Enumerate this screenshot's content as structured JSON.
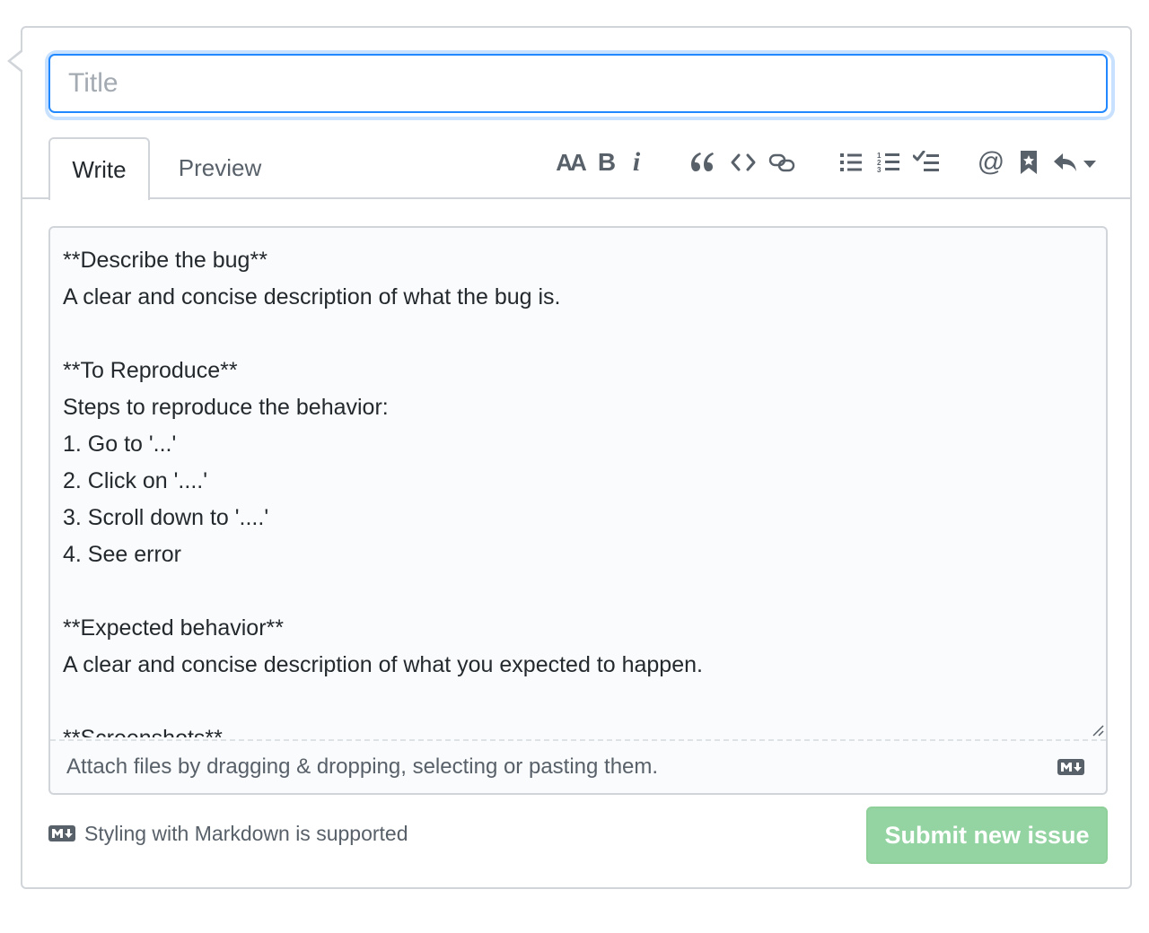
{
  "title": {
    "value": "",
    "placeholder": "Title"
  },
  "tabs": [
    {
      "label": "Write",
      "active": true
    },
    {
      "label": "Preview",
      "active": false
    }
  ],
  "toolbar": {
    "items": [
      {
        "name": "text-size-icon",
        "glyph": "AA"
      },
      {
        "name": "bold-icon",
        "glyph": "B"
      },
      {
        "name": "italic-icon",
        "glyph": "i"
      },
      {
        "name": "quote-icon"
      },
      {
        "name": "code-icon"
      },
      {
        "name": "link-icon"
      },
      {
        "name": "unordered-list-icon"
      },
      {
        "name": "ordered-list-icon"
      },
      {
        "name": "task-list-icon"
      },
      {
        "name": "mention-icon",
        "glyph": "@"
      },
      {
        "name": "reference-icon"
      },
      {
        "name": "reply-icon"
      },
      {
        "name": "dropdown-caret-icon"
      }
    ]
  },
  "editor": {
    "lines": [
      "**Describe the bug**",
      "A clear and concise description of what the bug is.",
      "",
      "**To Reproduce**",
      "Steps to reproduce the behavior:",
      "1. Go to '...'",
      "2. Click on '....'",
      "3. Scroll down to '....'",
      "4. See error",
      "",
      "**Expected behavior**",
      "A clear and concise description of what you expected to happen.",
      "",
      "**Screenshots**"
    ],
    "attach_text": "Attach files by dragging & dropping, selecting or pasting them."
  },
  "footer": {
    "markdown_note": "Styling with Markdown is supported",
    "submit_label": "Submit new issue"
  },
  "colors": {
    "accent_blue": "#2188ff",
    "submit_disabled": "#94d3a2",
    "icon_gray": "#586069",
    "border": "#d1d5da"
  }
}
